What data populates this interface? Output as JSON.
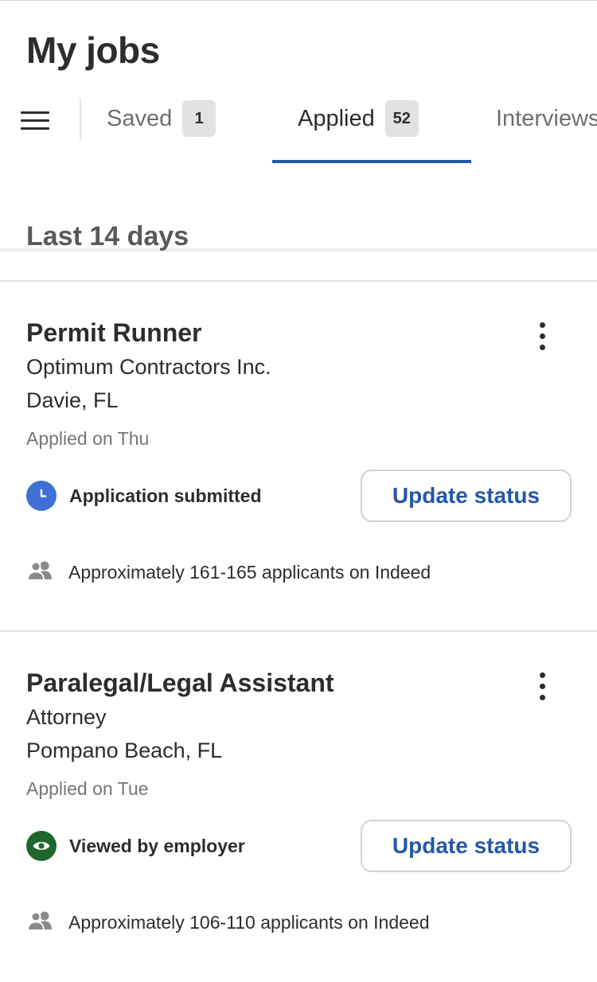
{
  "page": {
    "title": "My jobs"
  },
  "colors": {
    "accent": "#2557a7",
    "submitted_icon": "#3e6fd6",
    "viewed_icon": "#1f662c"
  },
  "icons": {
    "menu": "hamburger-menu-icon",
    "more": "vertical-ellipsis-icon",
    "submitted": "clock-icon",
    "viewed": "eye-icon",
    "applicants": "people-icon"
  },
  "tabs": [
    {
      "label": "Saved",
      "count": "1",
      "active": false
    },
    {
      "label": "Applied",
      "count": "52",
      "active": true
    },
    {
      "label": "Interviews",
      "count": "",
      "active": false
    }
  ],
  "section": {
    "heading": "Last 14 days"
  },
  "jobs": [
    {
      "title": "Permit Runner",
      "company": "Optimum Contractors Inc.",
      "location": "Davie, FL",
      "applied": "Applied on Thu",
      "status": "Application submitted",
      "action": "Update status",
      "applicants": "Approximately 161-165 applicants on Indeed"
    },
    {
      "title": "Paralegal/Legal Assistant",
      "company": "Attorney",
      "location": "Pompano Beach, FL",
      "applied": "Applied on Tue",
      "status": "Viewed by employer",
      "action": "Update status",
      "applicants": "Approximately 106-110 applicants on Indeed"
    }
  ]
}
